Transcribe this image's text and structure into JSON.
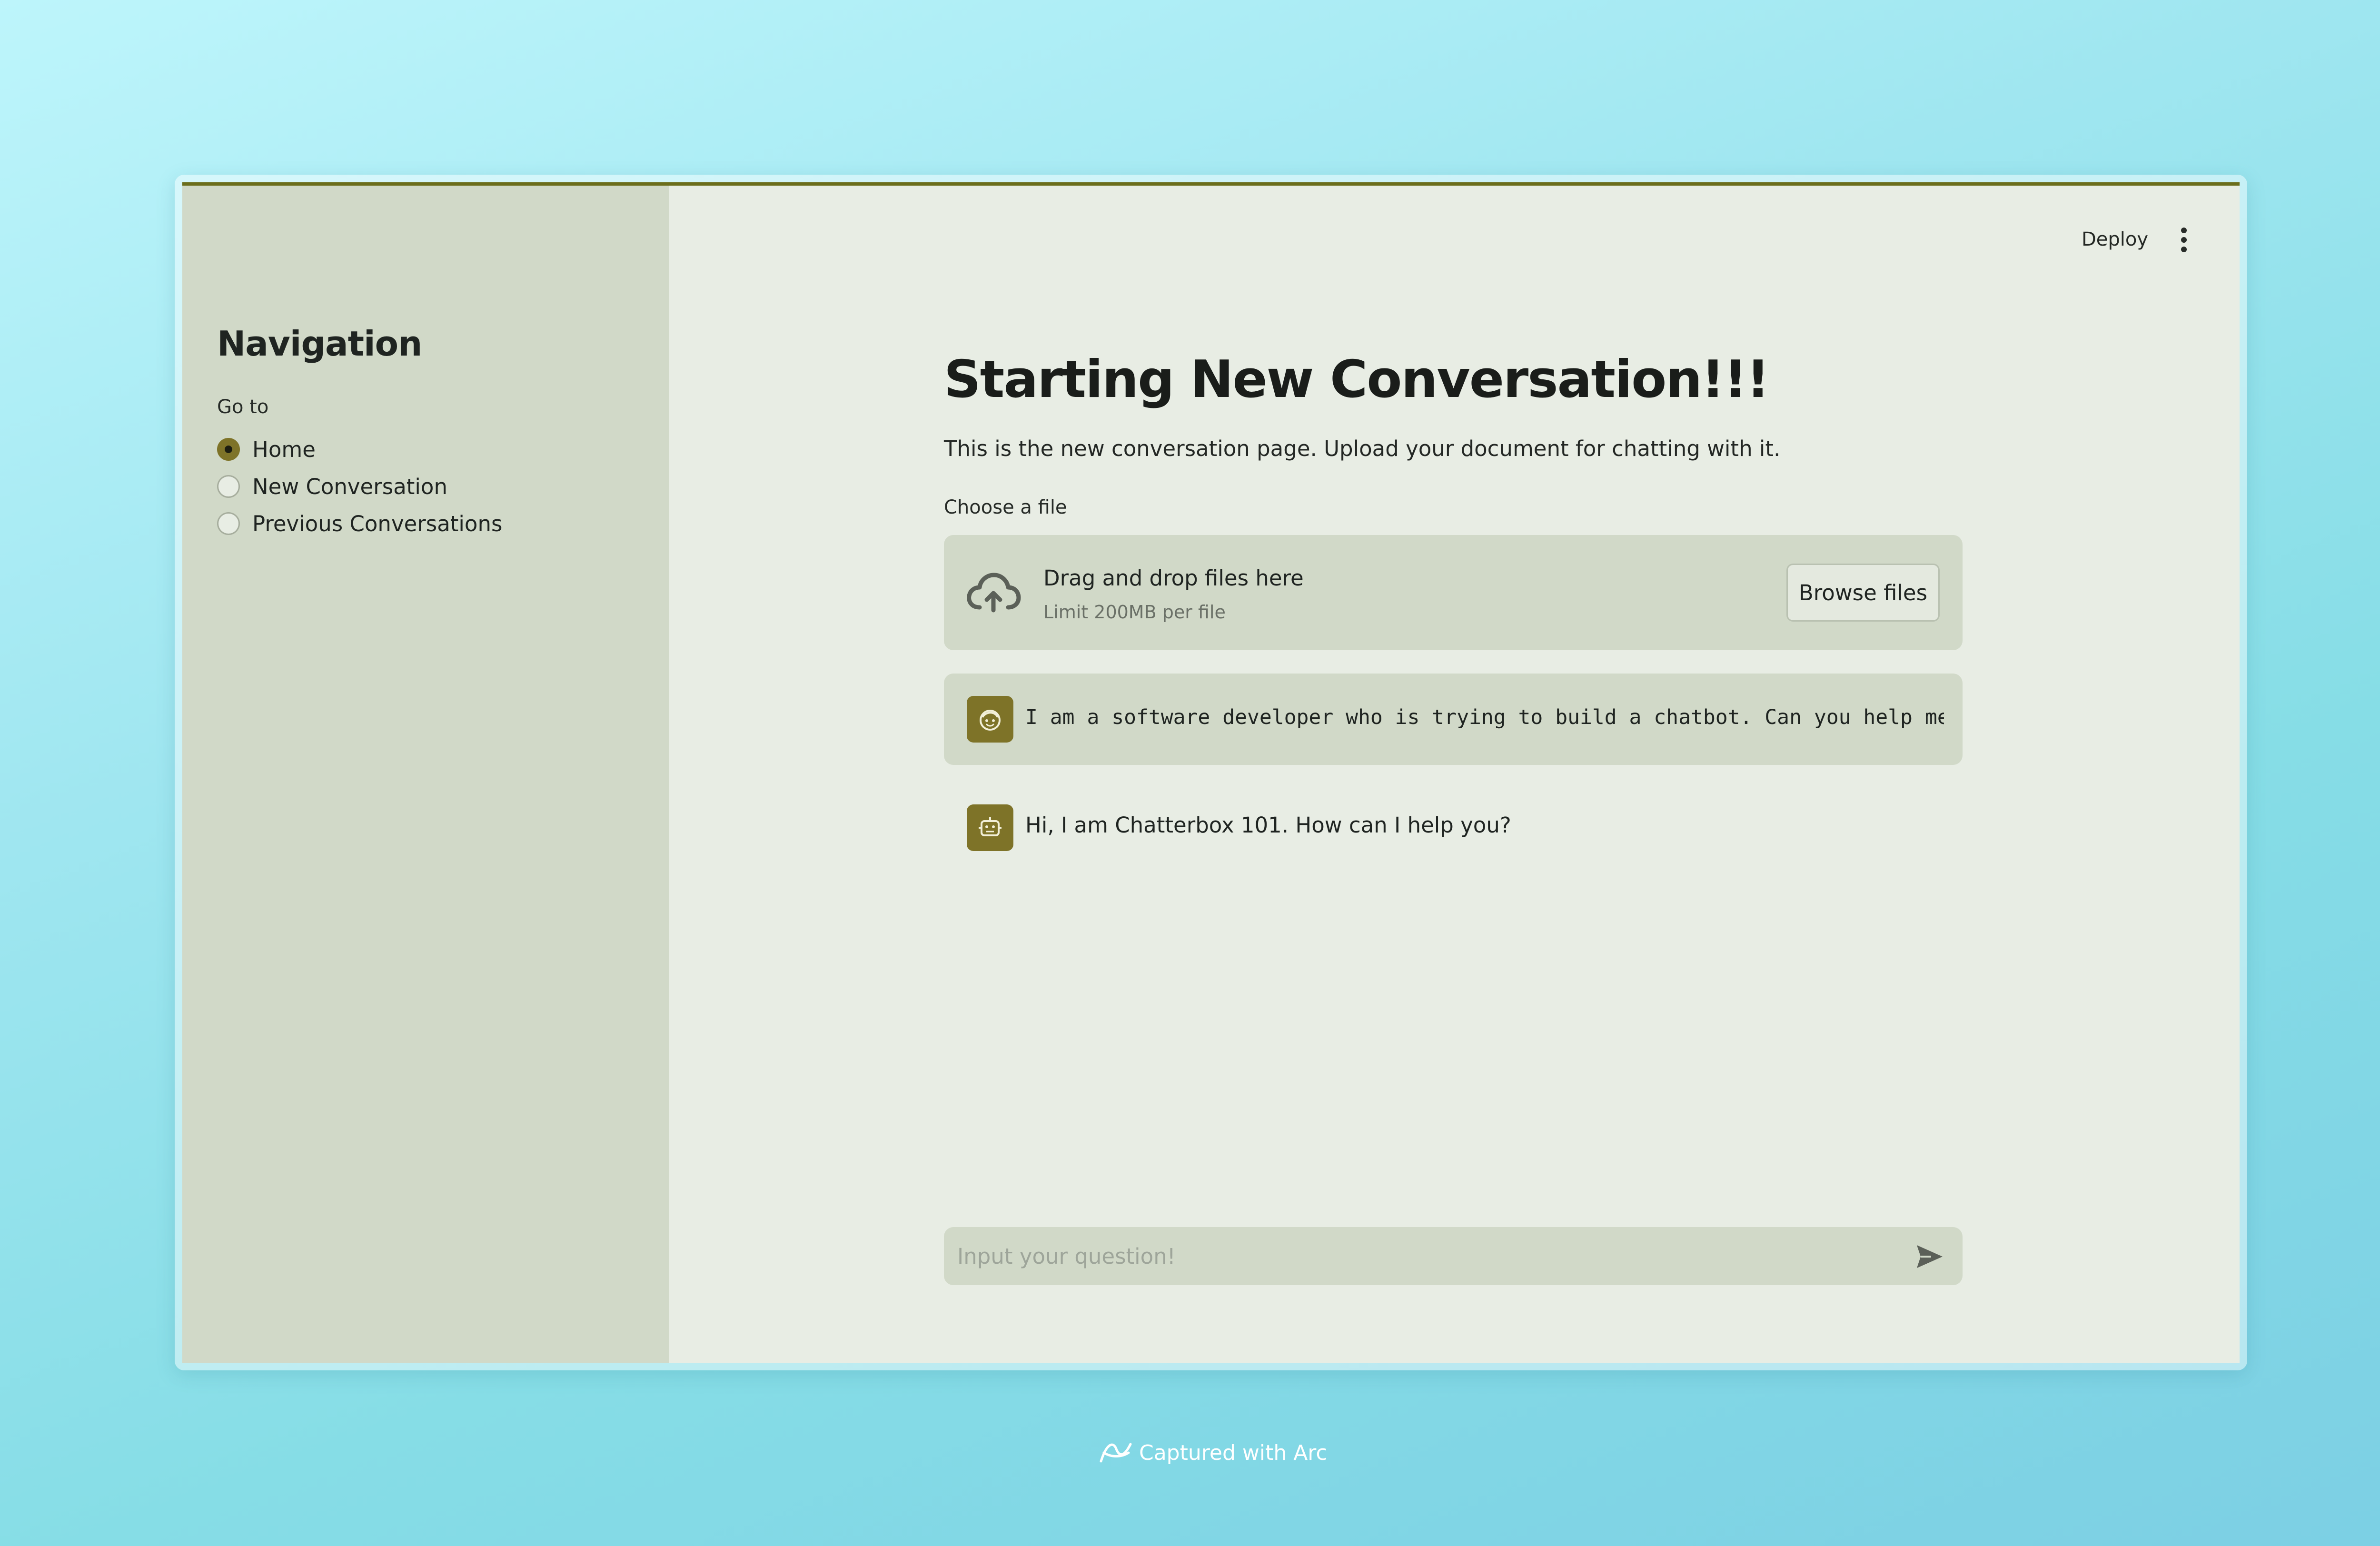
{
  "sidebar": {
    "title": "Navigation",
    "goto_label": "Go to",
    "options": [
      {
        "label": "Home",
        "checked": true
      },
      {
        "label": "New Conversation",
        "checked": false
      },
      {
        "label": "Previous Conversations",
        "checked": false
      }
    ]
  },
  "toolbar": {
    "deploy_label": "Deploy",
    "menu_icon": "kebab-menu-icon"
  },
  "main": {
    "title": "Starting New Conversation!!!",
    "description": "This is the new conversation page. Upload your document for chatting with it.",
    "uploader": {
      "label": "Choose a file",
      "drop_title": "Drag and drop files here",
      "limit": "Limit 200MB per file",
      "browse_label": "Browse files",
      "icon": "cloud-upload-icon"
    },
    "messages": [
      {
        "role": "user",
        "avatar_icon": "user-face-icon",
        "text": "I am a software developer who is trying to build a chatbot. Can you help me"
      },
      {
        "role": "assistant",
        "avatar_icon": "robot-icon",
        "text": "Hi, I am Chatterbox 101. How can I help you?"
      }
    ],
    "chat_input": {
      "placeholder": "Input your question!",
      "value": "",
      "send_icon": "send-icon"
    }
  },
  "footer": {
    "credit": "Captured with Arc",
    "icon": "arc-logo-icon"
  },
  "colors": {
    "accent": "#7e7328",
    "sidebar_bg": "#d1d9c8",
    "main_bg": "#e8ede4",
    "top_border": "#6b6e1c"
  }
}
